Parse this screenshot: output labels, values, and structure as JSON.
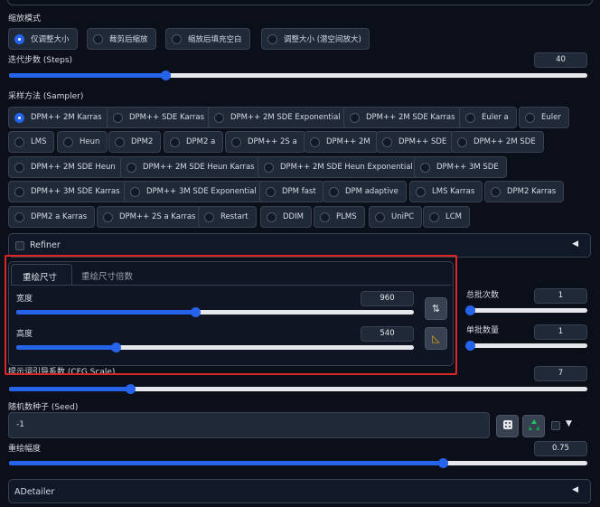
{
  "resize_mode": {
    "label": "缩放模式",
    "options": [
      "仅调整大小",
      "裁剪后缩放",
      "缩放后填充空白",
      "调整大小 (潜空间放大)"
    ],
    "selected": "仅调整大小"
  },
  "steps": {
    "label": "迭代步数 (Steps)",
    "value": "40",
    "fraction": 0.27
  },
  "sampler": {
    "label": "采样方法 (Sampler)",
    "selected": "DPM++ 2M Karras",
    "rows": [
      [
        "DPM++ 2M Karras",
        "DPM++ SDE Karras",
        "DPM++ 2M SDE Exponential",
        "DPM++ 2M SDE Karras",
        "Euler a",
        "Euler"
      ],
      [
        "LMS",
        "Heun",
        "DPM2",
        "DPM2 a",
        "DPM++ 2S a",
        "DPM++ 2M",
        "DPM++ SDE",
        "DPM++ 2M SDE"
      ],
      [
        "DPM++ 2M SDE Heun",
        "DPM++ 2M SDE Heun Karras",
        "DPM++ 2M SDE Heun Exponential",
        "DPM++ 3M SDE"
      ],
      [
        "DPM++ 3M SDE Karras",
        "DPM++ 3M SDE Exponential",
        "DPM fast",
        "DPM adaptive",
        "LMS Karras",
        "DPM2 Karras"
      ],
      [
        "DPM2 a Karras",
        "DPM++ 2S a Karras",
        "Restart",
        "DDIM",
        "PLMS",
        "UniPC",
        "LCM"
      ]
    ]
  },
  "refiner": {
    "label": "Refiner",
    "arrow": "◀"
  },
  "size_tabs": {
    "tab1": "重绘尺寸",
    "tab2": "重绘尺寸倍数"
  },
  "width": {
    "label": "宽度",
    "value": "960",
    "fraction": 0.45
  },
  "height": {
    "label": "高度",
    "value": "540",
    "fraction": 0.25
  },
  "swap_icon": "⇅",
  "ratio_icon": "◺",
  "batch_count": {
    "label": "总批次数",
    "value": "1",
    "fraction": 0.0
  },
  "batch_size": {
    "label": "单批数量",
    "value": "1",
    "fraction": 0.0
  },
  "cfg": {
    "label": "提示词引导系数 (CFG Scale)",
    "value": "7",
    "fraction": 0.21
  },
  "seed": {
    "label": "随机数种子 (Seed)",
    "value": "-1",
    "arrow": "▼"
  },
  "denoise": {
    "label": "重绘幅度",
    "value": "0.75",
    "fraction": 0.75
  },
  "adetailer": {
    "label": "ADetailer",
    "arrow": "◀"
  },
  "colors": {
    "accent": "#2563eb",
    "highlight": "#dc2626",
    "background": "#0b0f19"
  }
}
